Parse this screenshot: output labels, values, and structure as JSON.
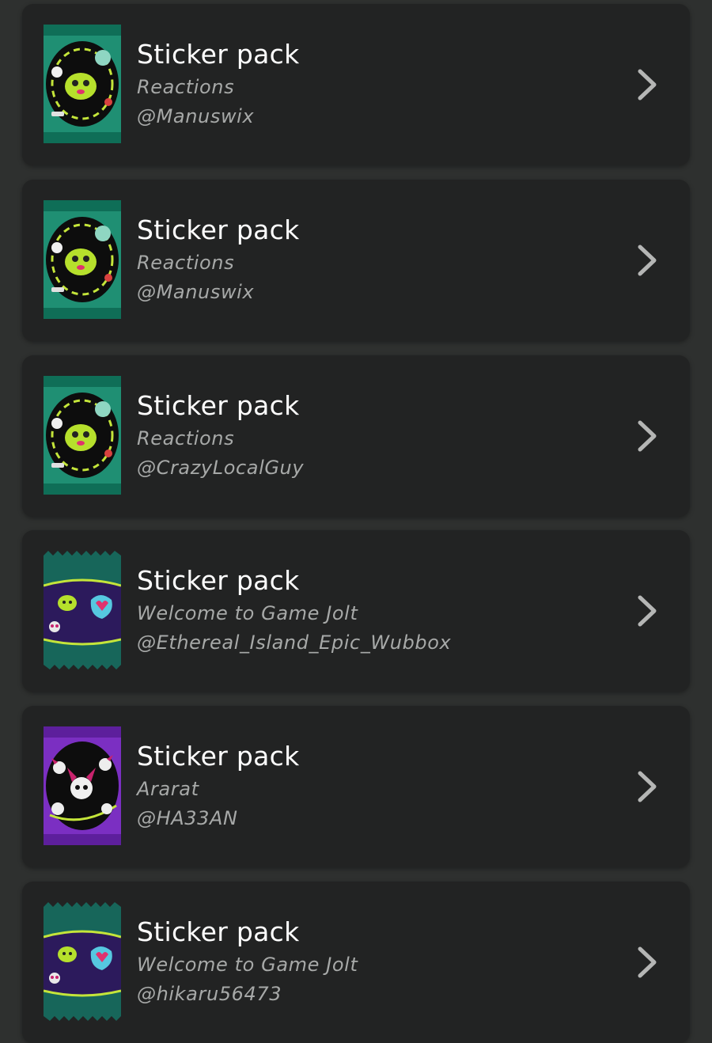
{
  "colors": {
    "background": "#2e302f",
    "card": "#222323",
    "title": "#ffffff",
    "secondary_text": "#a7a9a8",
    "chevron": "#b5b6b5"
  },
  "packs": [
    {
      "title": "Sticker pack",
      "subtitle": "Reactions",
      "owner": "@Manuswix",
      "art": "reactions-sticker-pack-icon",
      "pack_color": "#1f8f73"
    },
    {
      "title": "Sticker pack",
      "subtitle": "Reactions",
      "owner": "@Manuswix",
      "art": "reactions-sticker-pack-icon",
      "pack_color": "#1f8f73"
    },
    {
      "title": "Sticker pack",
      "subtitle": "Reactions",
      "owner": "@CrazyLocalGuy",
      "art": "reactions-sticker-pack-icon",
      "pack_color": "#1f8f73"
    },
    {
      "title": "Sticker pack",
      "subtitle": "Welcome to Game Jolt",
      "owner": "@Ethereal_Island_Epic_Wubbox",
      "art": "welcome-sticker-pack-icon",
      "pack_color": "#17665a"
    },
    {
      "title": "Sticker pack",
      "subtitle": "Ararat",
      "owner": "@HA33AN",
      "art": "ararat-sticker-pack-icon",
      "pack_color": "#7b2fc2"
    },
    {
      "title": "Sticker pack",
      "subtitle": "Welcome to Game Jolt",
      "owner": "@hikaru56473",
      "art": "welcome-sticker-pack-icon",
      "pack_color": "#17665a"
    }
  ]
}
